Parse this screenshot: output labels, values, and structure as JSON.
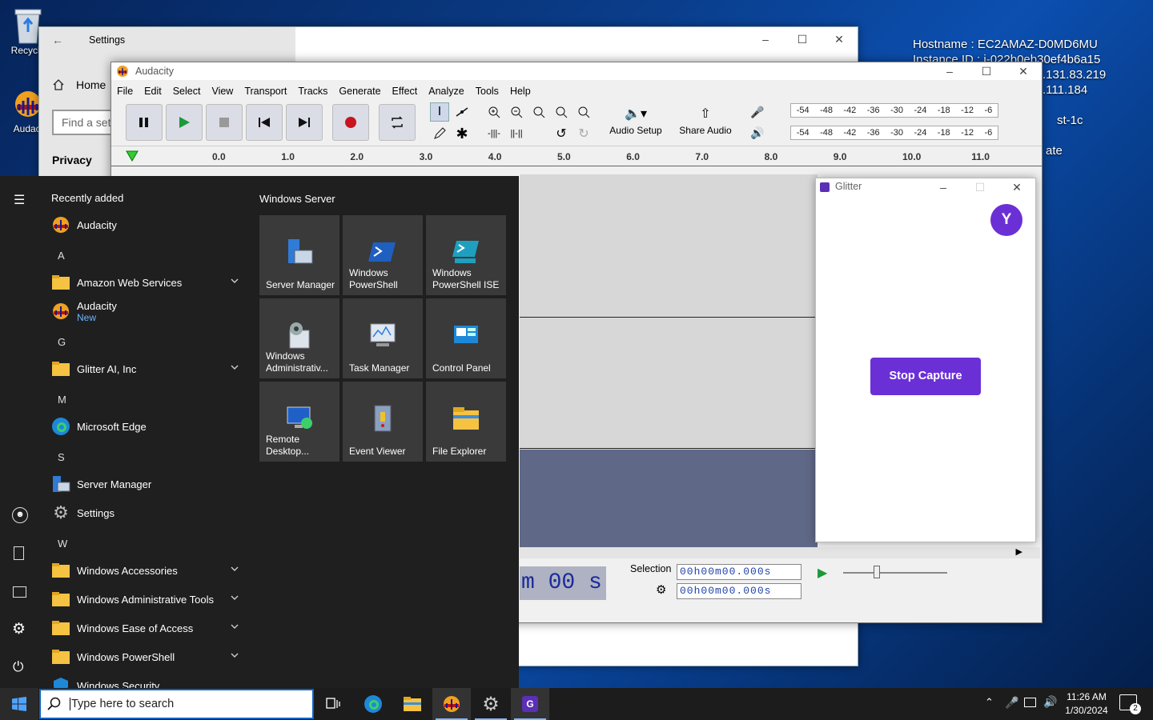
{
  "desktop": {
    "icons": [
      {
        "label": "Recycle"
      },
      {
        "label": "Audaci"
      }
    ],
    "info_lines": [
      "Hostname : EC2AMAZ-D0MD6MU",
      "Instance ID : i-022b0eb30ef4b6a15",
      ".131.83.219",
      ".111.184",
      "st-1c",
      "ate"
    ]
  },
  "settings": {
    "title": "Settings",
    "home": "Home",
    "search_placeholder": "Find a sett",
    "section": "Privacy"
  },
  "audacity": {
    "title": "Audacity",
    "menu": [
      "File",
      "Edit",
      "Select",
      "View",
      "Transport",
      "Tracks",
      "Generate",
      "Effect",
      "Analyze",
      "Tools",
      "Help"
    ],
    "audio_setup": "Audio Setup",
    "share_audio": "Share Audio",
    "meter_scale": [
      "-54",
      "-48",
      "-42",
      "-36",
      "-30",
      "-24",
      "-18",
      "-12",
      "-6"
    ],
    "ruler": [
      "0.0",
      "1.0",
      "2.0",
      "3.0",
      "4.0",
      "5.0",
      "6.0",
      "7.0",
      "8.0",
      "9.0",
      "10.0",
      "11.0"
    ],
    "time_display": "m 00 s",
    "selection_label": "Selection",
    "sel_start": "00h00m00.000s",
    "sel_end": "00h00m00.000s"
  },
  "glitter": {
    "title": "Glitter",
    "avatar": "Y",
    "stop_button": "Stop Capture",
    "accent": "#6b2fd6"
  },
  "start_menu": {
    "recently_added": "Recently added",
    "apps": [
      {
        "label": "Audacity"
      },
      {
        "label": "A"
      },
      {
        "label": "Amazon Web Services"
      },
      {
        "label": "Audacity",
        "sub": "New"
      },
      {
        "label": "G"
      },
      {
        "label": "Glitter AI, Inc"
      },
      {
        "label": "M"
      },
      {
        "label": "Microsoft Edge"
      },
      {
        "label": "S"
      },
      {
        "label": "Server Manager"
      },
      {
        "label": "Settings"
      },
      {
        "label": "W"
      },
      {
        "label": "Windows Accessories"
      },
      {
        "label": "Windows Administrative Tools"
      },
      {
        "label": "Windows Ease of Access"
      },
      {
        "label": "Windows PowerShell"
      },
      {
        "label": "Windows Security"
      }
    ],
    "group_title": "Windows Server",
    "tiles": [
      {
        "label": "Server Manager"
      },
      {
        "label": "Windows PowerShell"
      },
      {
        "label": "Windows PowerShell ISE"
      },
      {
        "label": "Windows Administrativ..."
      },
      {
        "label": "Task Manager"
      },
      {
        "label": "Control Panel"
      },
      {
        "label": "Remote Desktop..."
      },
      {
        "label": "Event Viewer"
      },
      {
        "label": "File Explorer"
      }
    ]
  },
  "taskbar": {
    "search_placeholder": "Type here to search",
    "time": "11:26 AM",
    "date": "1/30/2024",
    "notifications": "2"
  }
}
